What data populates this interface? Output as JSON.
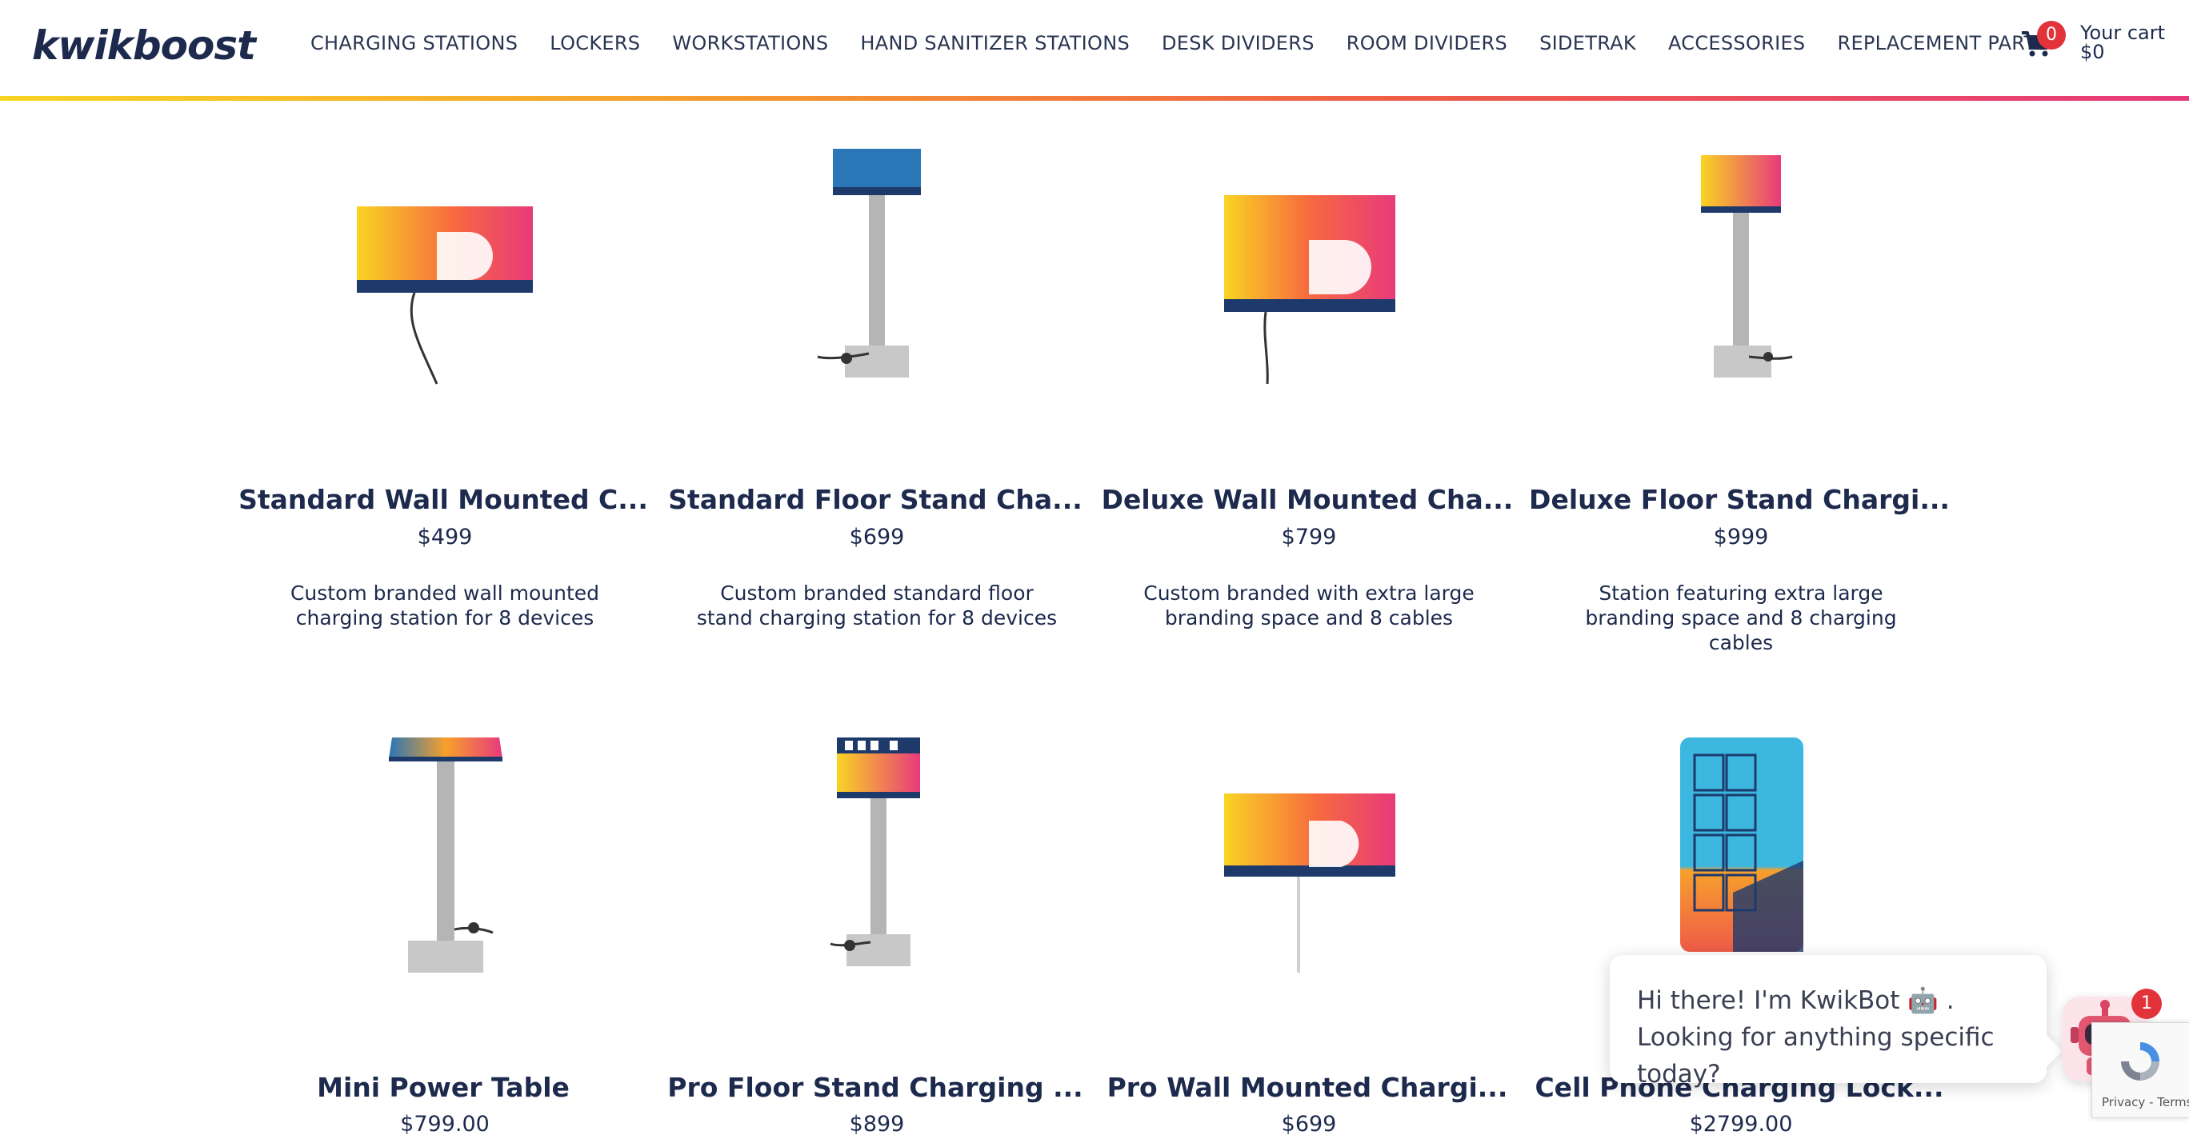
{
  "brand": {
    "logo_text": "kwikboost"
  },
  "nav": {
    "items": [
      "CHARGING STATIONS",
      "LOCKERS",
      "WORKSTATIONS",
      "HAND SANITIZER STATIONS",
      "DESK DIVIDERS",
      "ROOM DIVIDERS",
      "SIDETRAK",
      "ACCESSORIES",
      "REPLACEMENT PARTS"
    ]
  },
  "cart": {
    "count": "0",
    "label": "Your cart",
    "total": "$0"
  },
  "products": [
    {
      "title": "Standard Wall Mounted C...",
      "price": "$499",
      "description": "Custom branded wall mounted charging station for 8 devices"
    },
    {
      "title": "Standard Floor Stand Cha...",
      "price": "$699",
      "description": "Custom branded standard floor stand charging station for 8 devices"
    },
    {
      "title": "Deluxe Wall Mounted Cha...",
      "price": "$799",
      "description": "Custom branded with extra large branding space and 8 cables"
    },
    {
      "title": "Deluxe Floor Stand Chargi...",
      "price": "$999",
      "description": "Station featuring extra large branding space and 8 charging cables"
    },
    {
      "title": "Mini Power Table",
      "price": "$799.00",
      "description": ""
    },
    {
      "title": "Pro Floor Stand Charging ...",
      "price": "$899",
      "description": ""
    },
    {
      "title": "Pro Wall Mounted Chargi...",
      "price": "$699",
      "description": ""
    },
    {
      "title": "Cell Phone Charging Lock...",
      "price": "$2799.00",
      "description": ""
    }
  ],
  "chat": {
    "message": "Hi there! I'm KwikBot 🤖 . Looking for anything specific today?",
    "badge": "1"
  },
  "recaptcha": {
    "links": "Privacy - Terms"
  },
  "colors": {
    "navy": "#1d2a4d",
    "badge_red": "#e2333a",
    "brand_gradient": [
      "#f9d423",
      "#ef5b48",
      "#e73a7b"
    ]
  }
}
